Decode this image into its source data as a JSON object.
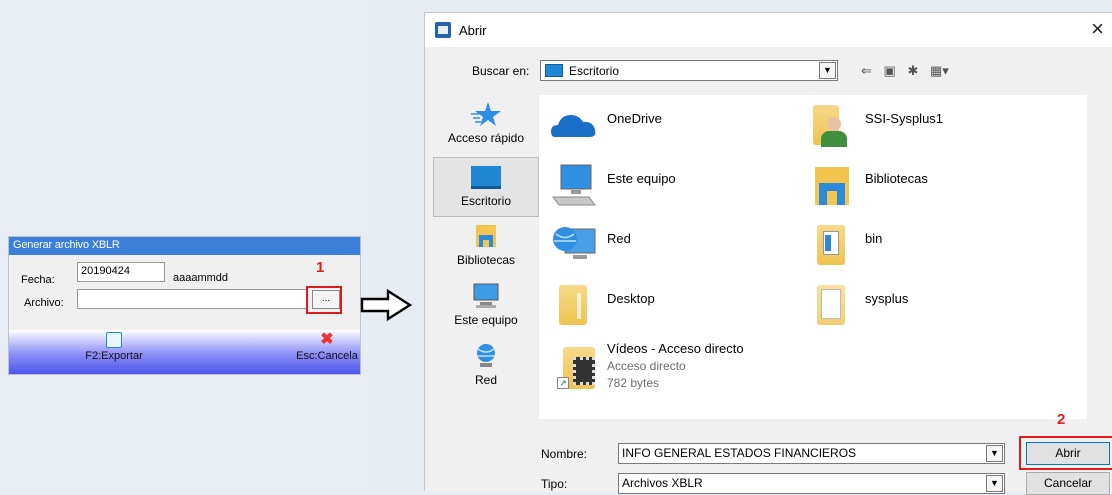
{
  "xblr_form": {
    "title": "Generar archivo XBLR",
    "date_label": "Fecha:",
    "date_value": "20190424",
    "date_format_hint": "aaaammdd",
    "file_label": "Archivo:",
    "file_value": "",
    "browse_label": "...",
    "export_label": "F2:Exportar",
    "cancel_label": "Esc:Cancela"
  },
  "annotations": {
    "step1": "1",
    "step2": "2",
    "highlight_color": "#e01b1b"
  },
  "dialog": {
    "title": "Abrir",
    "close_glyph": "×",
    "lookin_label": "Buscar en:",
    "lookin_value": "Escritorio",
    "places": [
      {
        "label": "Acceso rápido",
        "icon": "star-icon"
      },
      {
        "label": "Escritorio",
        "icon": "desktop-icon"
      },
      {
        "label": "Bibliotecas",
        "icon": "libraries-icon"
      },
      {
        "label": "Este equipo",
        "icon": "computer-icon"
      },
      {
        "label": "Red",
        "icon": "network-icon"
      }
    ],
    "files": [
      {
        "name": "OneDrive",
        "icon": "onedrive-icon"
      },
      {
        "name": "SSI-Sysplus1",
        "icon": "user-folder-icon"
      },
      {
        "name": "Este equipo",
        "icon": "computer-icon"
      },
      {
        "name": "Bibliotecas",
        "icon": "libraries-icon"
      },
      {
        "name": "Red",
        "icon": "network-icon"
      },
      {
        "name": "bin",
        "icon": "folder-icon"
      },
      {
        "name": "Desktop",
        "icon": "folder-icon"
      },
      {
        "name": "sysplus",
        "icon": "folder-icon"
      },
      {
        "name": "Vídeos - Acceso directo",
        "type": "Acceso directo",
        "size": "782 bytes",
        "icon": "video-shortcut-icon"
      }
    ],
    "filename_label": "Nombre:",
    "filename_value": "INFO GENERAL ESTADOS FINANCIEROS",
    "filetype_label": "Tipo:",
    "filetype_value": "Archivos XBLR",
    "open_label": "Abrir",
    "cancel_label": "Cancelar"
  }
}
